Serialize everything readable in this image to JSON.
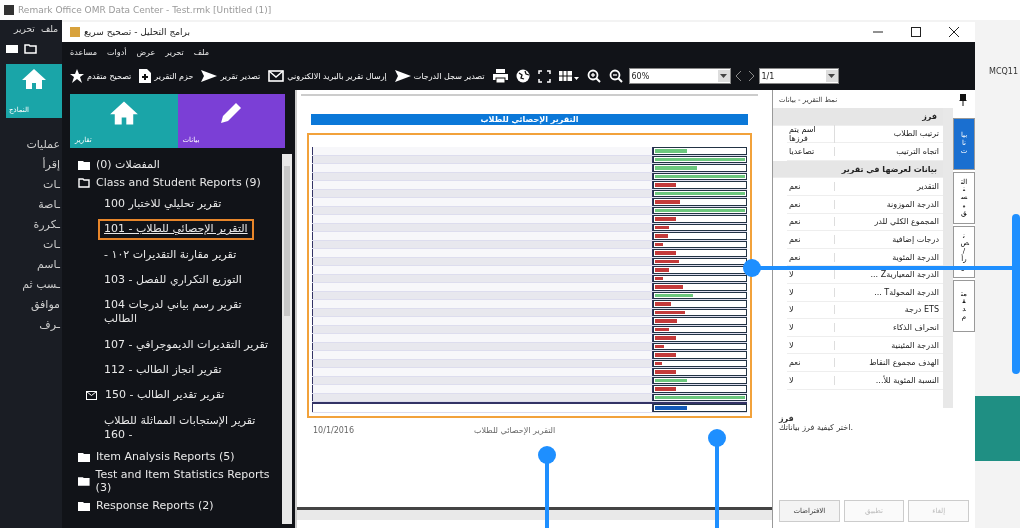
{
  "outer_window": {
    "title": "Remark Office OMR Data Center - Test.rmk [Untitled (1)]",
    "menu": [
      "ملف",
      "تحرير"
    ],
    "tile": {
      "label": "النماذج"
    },
    "side_items": [
      "عمليات",
      "إقرأ",
      "ـات",
      "ـاصة",
      "ـكررة",
      "ـات",
      "ـاسم",
      "ـسب ثم",
      "موافق",
      "ـرف"
    ],
    "right_header": "MCQ11"
  },
  "window": {
    "title": "برامج التحليل - تصحيح سريع"
  },
  "menu": [
    "ملف",
    "تحرير",
    "عرض",
    "أدوات",
    "مساعدة"
  ],
  "page": {
    "value": "1/1"
  },
  "zoom": {
    "value": "60%"
  },
  "toolbar": [
    {
      "kind": "zoom-out"
    },
    {
      "kind": "zoom-in"
    },
    {
      "kind": "grid"
    },
    {
      "kind": "expand"
    },
    {
      "kind": "globe"
    },
    {
      "kind": "print"
    },
    {
      "kind": "send",
      "label": "تصدير سجل الدرجات"
    },
    {
      "kind": "mail",
      "label": "إرسال تقرير بالبريد الالكتروني"
    },
    {
      "kind": "send",
      "label": "تصدير تقرير"
    },
    {
      "kind": "package",
      "label": "حزم التقرير"
    },
    {
      "kind": "star",
      "label": "تصحيح متقدم"
    }
  ],
  "tiles": [
    {
      "kind": "pencil",
      "label": "بيانات",
      "color": "#7b3fd6"
    },
    {
      "kind": "home",
      "label": "تقارير",
      "color": "#1aa5a8"
    }
  ],
  "tree": [
    {
      "label": "(0) المفضلات",
      "expanded": false
    },
    {
      "label": "Class and Student Reports (9)",
      "expanded": true,
      "children": [
        {
          "label": "100 تقرير تحليلي للاختبار",
          "selected": false,
          "email": false
        },
        {
          "label": "101 - التقرير الإحصائي للطلاب",
          "selected": true,
          "email": false
        },
        {
          "label": "- تقرير مقارنة التقديرات ١٠٢",
          "selected": false,
          "email": false
        },
        {
          "label": "103 - التوزيع التكراري للفصل",
          "selected": false,
          "email": false
        },
        {
          "label": "104 تقرير رسم بياني لدرجات الطالب",
          "selected": false,
          "email": false
        },
        {
          "label": "107 - تقرير التقديرات الديموجرافي",
          "selected": false,
          "email": false
        },
        {
          "label": "112 - تقرير انجاز الطالب",
          "selected": false,
          "email": false
        },
        {
          "label": "150 - تقرير تقدير الطالب",
          "selected": false,
          "email": true
        },
        {
          "label": "تقرير الإستجابات المماثلة للطلاب 160 -",
          "selected": false,
          "email": false
        }
      ]
    },
    {
      "label": "Item Analysis Reports (5)",
      "expanded": false
    },
    {
      "label": "Test and Item Statistics Reports (3)",
      "expanded": false
    },
    {
      "label": "Response Reports (2)",
      "expanded": false
    }
  ],
  "report": {
    "title": "التقرير الإحصائي للطلاب",
    "footer_date": "10/1/2016",
    "footer_title": "التقرير الإحصائي للطلاب",
    "rows": [
      {
        "level": 0.36,
        "passed": true
      },
      {
        "level": 1,
        "passed": true
      },
      {
        "level": 0.47,
        "passed": true
      },
      {
        "level": 1,
        "passed": true
      },
      {
        "level": 0.23,
        "passed": false
      },
      {
        "level": 1,
        "passed": true
      },
      {
        "level": 0.28,
        "passed": false
      },
      {
        "level": 1,
        "passed": true
      },
      {
        "level": 0.23,
        "passed": false
      },
      {
        "level": 0.16,
        "passed": false
      },
      {
        "level": 0.14,
        "passed": false
      },
      {
        "level": 0.09,
        "passed": false
      },
      {
        "level": 0.23,
        "passed": false
      },
      {
        "level": 0.27,
        "passed": false
      },
      {
        "level": 0.16,
        "passed": false
      },
      {
        "level": 0.09,
        "passed": false
      },
      {
        "level": 0.31,
        "passed": false
      },
      {
        "level": 0.42,
        "passed": true
      },
      {
        "level": 0.18,
        "passed": false
      },
      {
        "level": 0.33,
        "passed": false
      },
      {
        "level": 0.24,
        "passed": false
      },
      {
        "level": 0.16,
        "passed": false
      },
      {
        "level": 0.23,
        "passed": false
      },
      {
        "level": 0.1,
        "passed": false
      },
      {
        "level": 0.23,
        "passed": false
      },
      {
        "level": 0.08,
        "passed": false
      },
      {
        "level": 0.23,
        "passed": false
      },
      {
        "level": 0.36,
        "passed": true
      },
      {
        "level": 0.23,
        "passed": false
      },
      {
        "level": 1,
        "passed": true
      }
    ],
    "total": {
      "level": 0.36
    }
  },
  "properties": {
    "title": "نمط التقرير - بيانات",
    "rows": [
      {
        "kind": "group",
        "name": "فرز"
      },
      {
        "kind": "prop",
        "name": "ترتيب الطلاب",
        "value": "اسم يتم فرزها"
      },
      {
        "kind": "prop",
        "name": "اتجاه الترتيب",
        "value": "تصاعديا"
      },
      {
        "kind": "group",
        "name": "بيانات لعرضها في تقرير"
      },
      {
        "kind": "prop",
        "name": "التقدير",
        "value": "نعم"
      },
      {
        "kind": "prop",
        "name": "الدرجة الموزونة",
        "value": "نعم"
      },
      {
        "kind": "prop",
        "name": "المجموع الكلي للدر",
        "value": "نعم"
      },
      {
        "kind": "prop",
        "name": "درجات إضافية",
        "value": "نعم"
      },
      {
        "kind": "prop",
        "name": "الدرجة المئوية",
        "value": "نعم"
      },
      {
        "kind": "prop",
        "name": "... Zالدرجة المعيارية",
        "value": "لا"
      },
      {
        "kind": "prop",
        "name": "... Tالدرجة المحولة",
        "value": "لا"
      },
      {
        "kind": "prop",
        "name": "درجة ETS",
        "value": "لا"
      },
      {
        "kind": "prop",
        "name": "انحراف الذكاء",
        "value": "لا"
      },
      {
        "kind": "prop",
        "name": "الدرجة المئينية",
        "value": "لا"
      },
      {
        "kind": "prop",
        "name": "الهدف مجموع النقاط",
        "value": "نعم"
      },
      {
        "kind": "prop",
        "name": "...النسبة المئوية للأ",
        "value": "لا"
      }
    ],
    "tabs": [
      {
        "label": "بيانات",
        "selected": true
      },
      {
        "label": "التنسيق",
        "selected": false
      },
      {
        "label": "نص / رأس",
        "selected": false
      },
      {
        "label": "متقدم",
        "selected": false
      }
    ],
    "help_title": "فرز",
    "help_text": "اختر كيفية فرز بياناتك.",
    "buttons": [
      {
        "label": "إلغاء",
        "disabled": true
      },
      {
        "label": "تطبيق",
        "disabled": true
      },
      {
        "label": "الافتراضات",
        "disabled": false
      }
    ]
  }
}
